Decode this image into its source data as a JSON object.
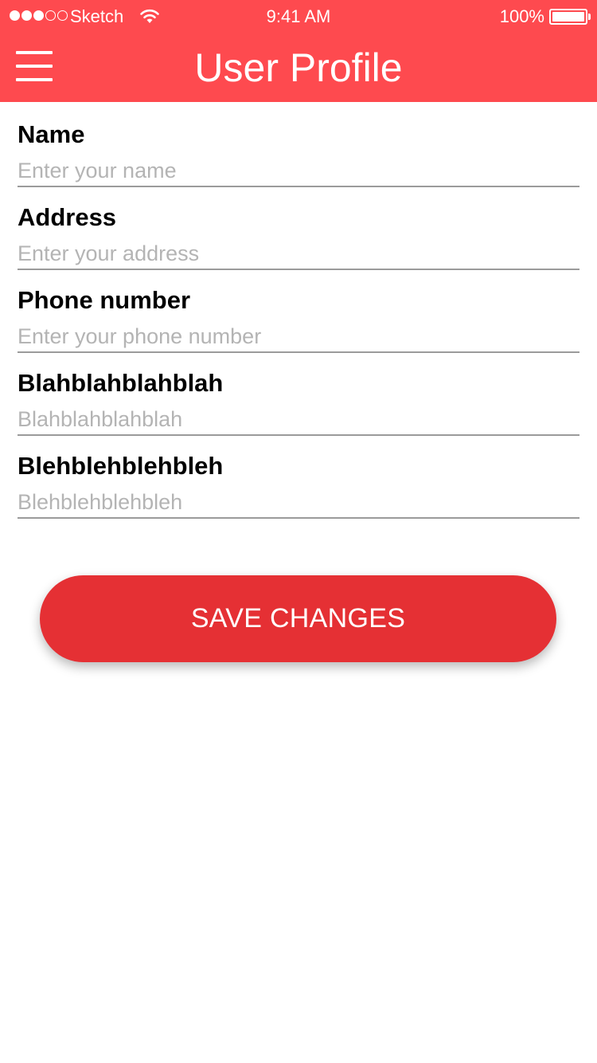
{
  "status_bar": {
    "carrier": "Sketch",
    "time": "9:41 AM",
    "battery_percent": "100%",
    "signal_strength": 3,
    "signal_max": 5,
    "battery_level": 1.0
  },
  "nav": {
    "title": "User Profile",
    "menu_icon": "hamburger-menu-icon"
  },
  "form": {
    "fields": [
      {
        "label": "Name",
        "placeholder": "Enter your name",
        "value": ""
      },
      {
        "label": "Address",
        "placeholder": "Enter your address",
        "value": ""
      },
      {
        "label": "Phone number",
        "placeholder": "Enter your phone number",
        "value": ""
      },
      {
        "label": "Blahblahblahblah",
        "placeholder": "Blahblahblahblah",
        "value": ""
      },
      {
        "label": "Blehblehblehbleh",
        "placeholder": "Blehblehblehbleh",
        "value": ""
      }
    ]
  },
  "save_button": {
    "label": "SAVE CHANGES"
  },
  "colors": {
    "header": "#fe4a4f",
    "button": "#e53034",
    "field_underline": "#9b9b9b",
    "placeholder": "#b4b4b4"
  }
}
